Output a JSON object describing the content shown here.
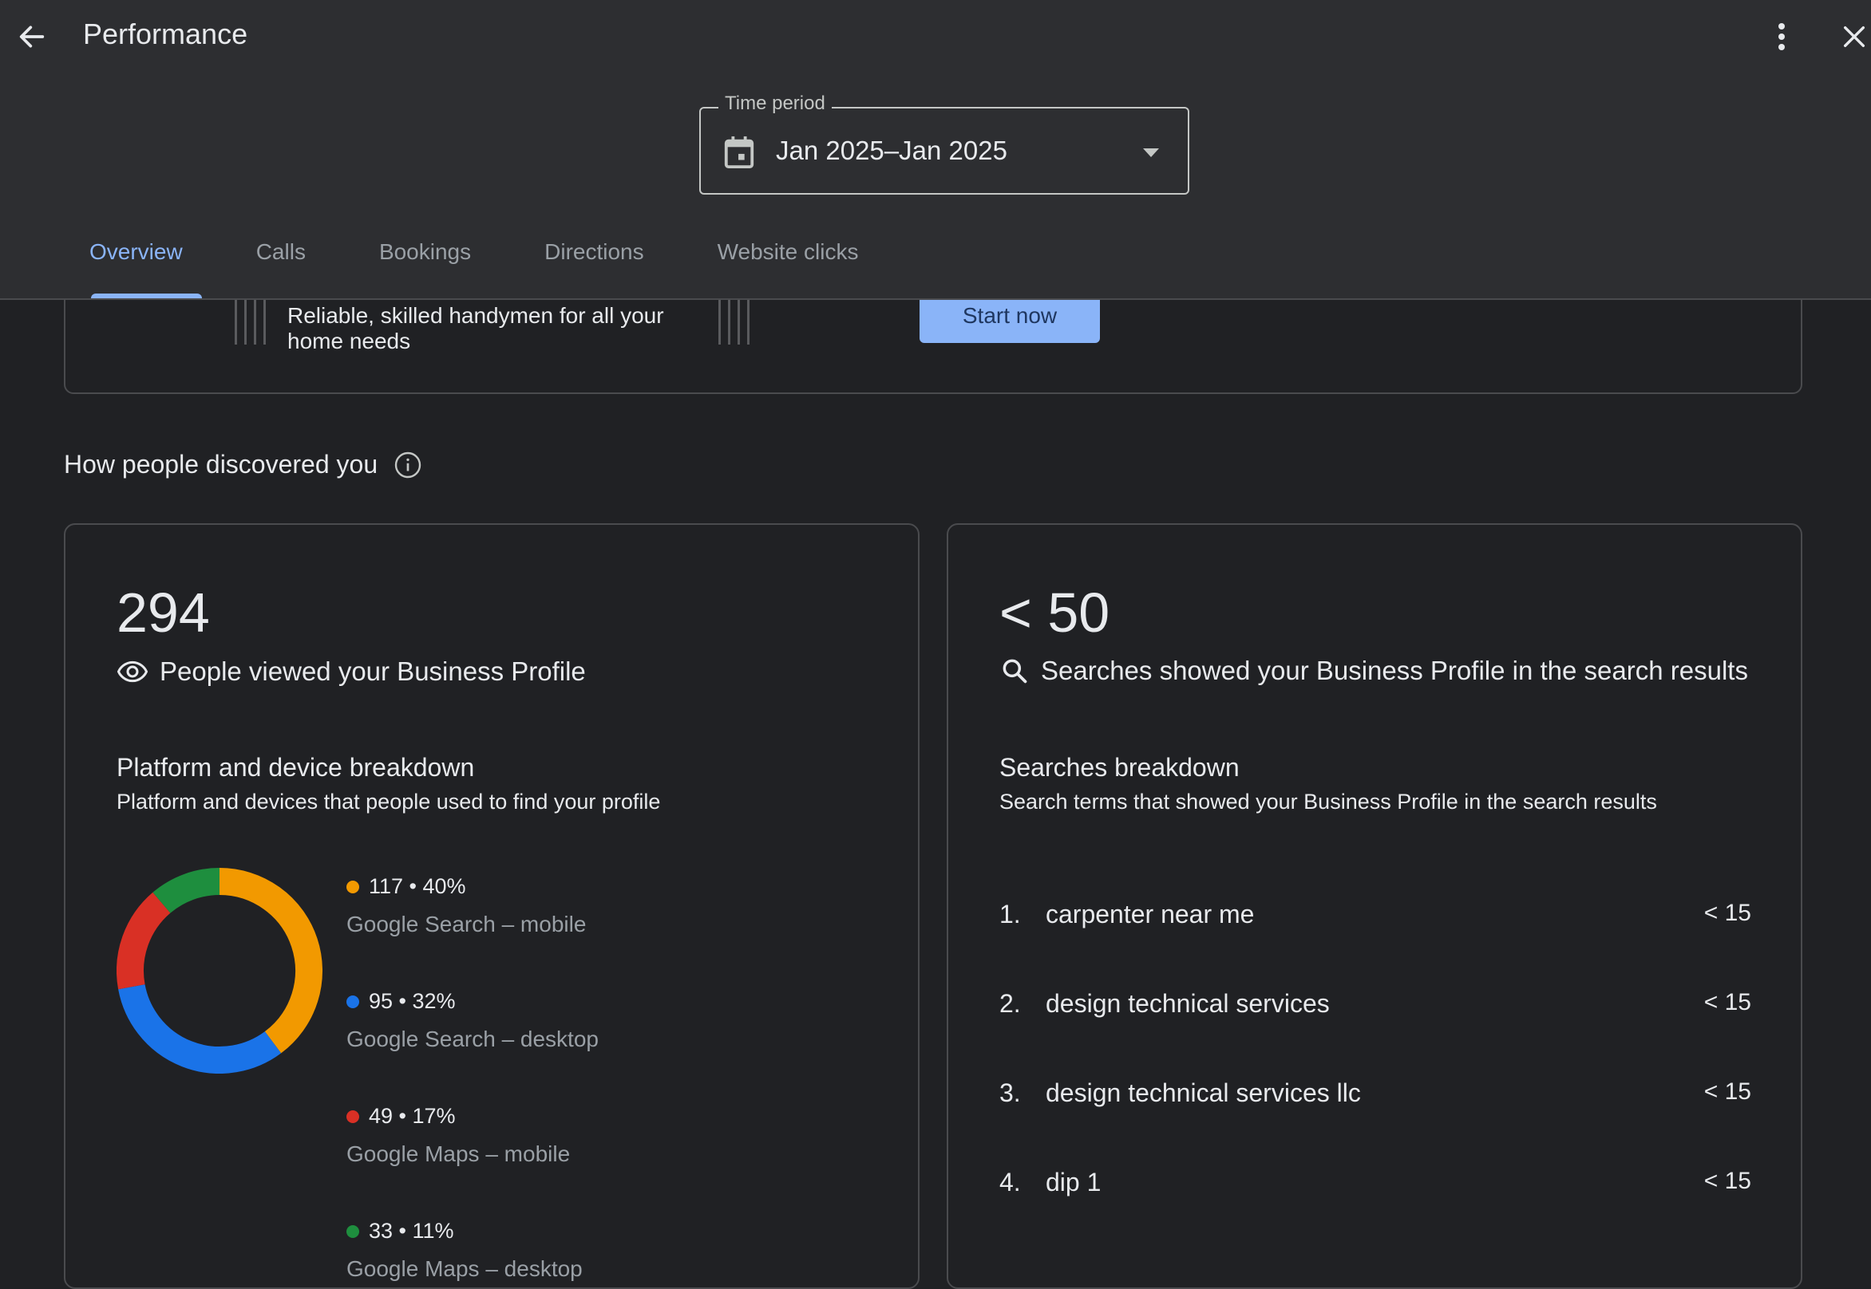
{
  "header": {
    "title": "Performance",
    "time_period_label": "Time period",
    "time_period_value": "Jan 2025–Jan 2025",
    "tabs": [
      {
        "label": "Overview"
      },
      {
        "label": "Calls"
      },
      {
        "label": "Bookings"
      },
      {
        "label": "Directions"
      },
      {
        "label": "Website clicks"
      }
    ]
  },
  "promo": {
    "text_line1": "Reliable, skilled handymen for all your",
    "text_line2": "home needs",
    "button_label": "Start now"
  },
  "discovery": {
    "title": "How people discovered you"
  },
  "views_card": {
    "count": "294",
    "label": "People viewed your Business Profile",
    "breakdown_title": "Platform and device breakdown",
    "breakdown_desc": "Platform and devices that people used to find your profile",
    "legend": [
      {
        "value_text": "117 • 40%",
        "label": "Google Search – mobile",
        "color": "#f29900"
      },
      {
        "value_text": "95 • 32%",
        "label": "Google Search – desktop",
        "color": "#1a73e8"
      },
      {
        "value_text": "49 • 17%",
        "label": "Google Maps – mobile",
        "color": "#d93025"
      },
      {
        "value_text": "33 • 11%",
        "label": "Google Maps – desktop",
        "color": "#1e8e3e"
      }
    ]
  },
  "chart_data": {
    "type": "pie",
    "categories": [
      "Google Search – mobile",
      "Google Search – desktop",
      "Google Maps – mobile",
      "Google Maps – desktop"
    ],
    "values": [
      117,
      95,
      49,
      33
    ],
    "percents": [
      40,
      32,
      17,
      11
    ],
    "colors": [
      "#f29900",
      "#1a73e8",
      "#d93025",
      "#1e8e3e"
    ]
  },
  "search_card": {
    "count": "< 50",
    "label": "Searches showed your Business Profile in the search results",
    "breakdown_title": "Searches breakdown",
    "breakdown_desc": "Search terms that showed your Business Profile in the search results",
    "rows": [
      {
        "rank": "1.",
        "term": "carpenter near me",
        "count": "< 15"
      },
      {
        "rank": "2.",
        "term": "design technical services",
        "count": "< 15"
      },
      {
        "rank": "3.",
        "term": "design technical services llc",
        "count": "< 15"
      },
      {
        "rank": "4.",
        "term": "dip 1",
        "count": "< 15"
      }
    ]
  },
  "icons": {
    "back": "arrow-left-icon",
    "more": "more-vert-icon",
    "close": "close-icon",
    "calendar": "calendar-icon",
    "info": "info-icon",
    "eye": "eye-icon",
    "search": "search-icon"
  }
}
